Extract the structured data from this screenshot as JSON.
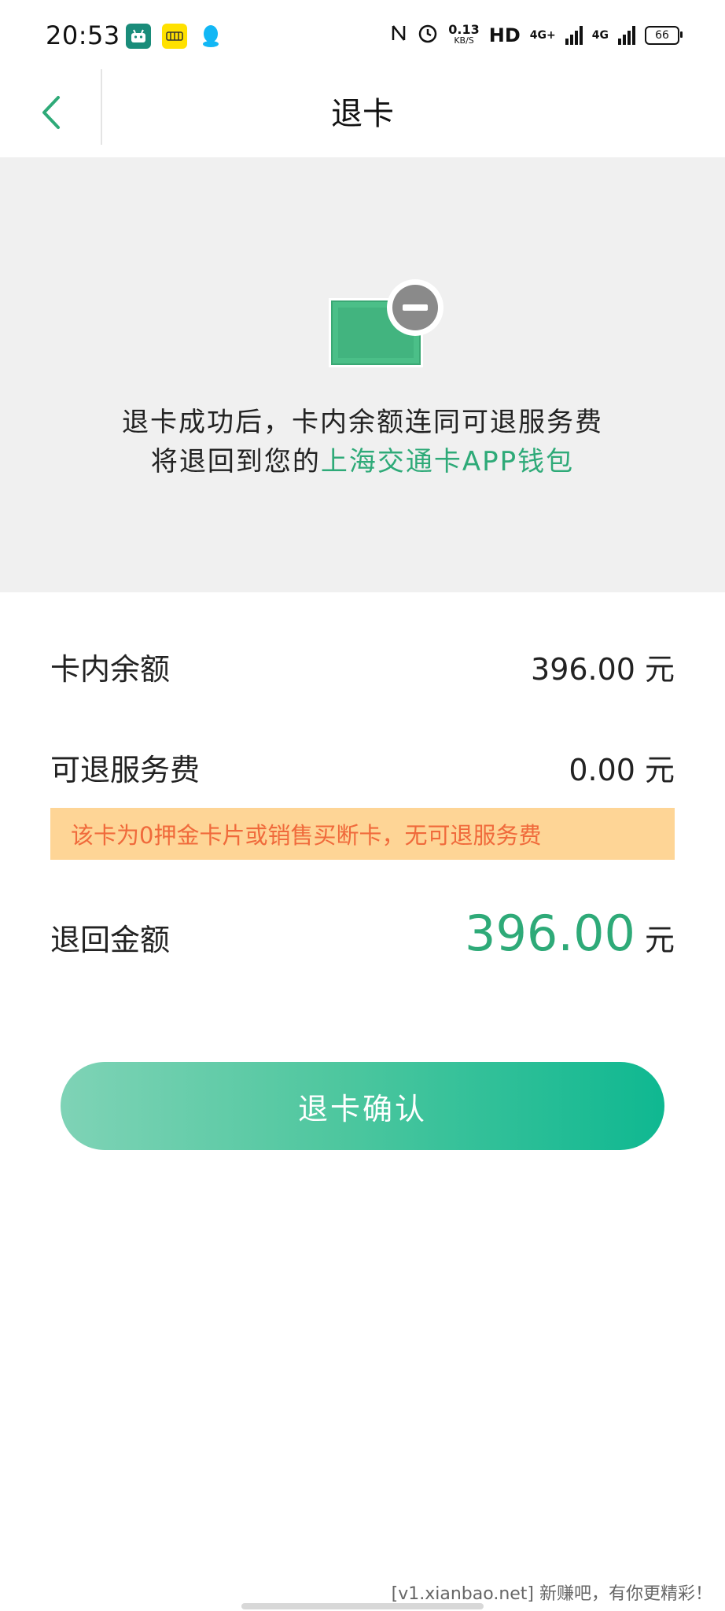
{
  "status_bar": {
    "time": "20:53",
    "app_icons": [
      "android-icon",
      "xianyu-icon",
      "qq-icon"
    ],
    "speed_value": "0.13",
    "speed_unit": "KB/S",
    "hd_label": "HD",
    "network_1": "4G+",
    "network_2": "4G",
    "battery": "66"
  },
  "header": {
    "title": "退卡"
  },
  "notice": {
    "line1": "退卡成功后，卡内余额连同可退服务费",
    "line2_prefix": "将退回到您的",
    "line2_highlight": "上海交通卡APP钱包"
  },
  "details": {
    "balance_label": "卡内余额",
    "balance_value": "396.00",
    "balance_unit": "元",
    "fee_label": "可退服务费",
    "fee_value": "0.00",
    "fee_unit": "元",
    "warning": "该卡为0押金卡片或销售买断卡，无可退服务费",
    "refund_label": "退回金额",
    "refund_value": "396.00",
    "refund_unit": "元"
  },
  "actions": {
    "confirm_label": "退卡确认"
  },
  "footer": {
    "watermark": "[v1.xianbao.net] 新赚吧，有你更精彩！"
  },
  "colors": {
    "accent": "#2eaa78",
    "warning_bg": "#fed596",
    "warning_text": "#f06a3b",
    "panel_bg": "#f0f0f0"
  }
}
